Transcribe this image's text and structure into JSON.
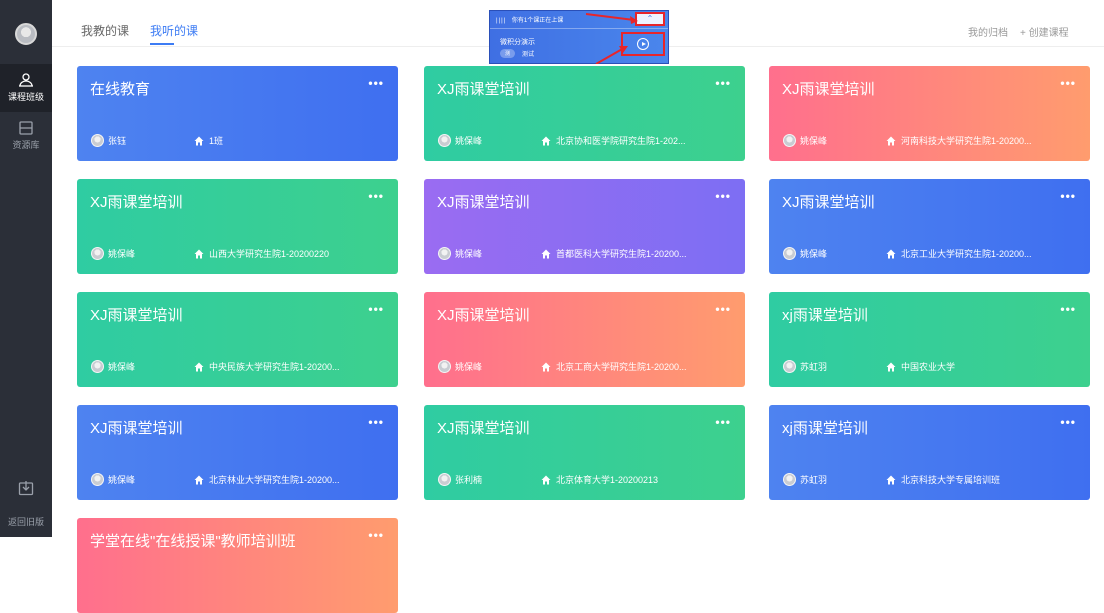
{
  "tabs": [
    {
      "label": "我教的课"
    },
    {
      "label": "我听的课"
    }
  ],
  "top_actions": {
    "archive": "我的归档",
    "create": "+ 创建课程"
  },
  "sidebar": {
    "items": [
      {
        "label": "课程班级"
      },
      {
        "label": "资源库"
      }
    ],
    "back_label": "返回旧版"
  },
  "notice": {
    "bars": "||||",
    "message": "你有1个课正在上课",
    "title": "微积分演示",
    "pill": "测",
    "sub": "测试"
  },
  "cards": [
    {
      "title": "在线教育",
      "teacher": "张钰",
      "class": "1班",
      "color": "blue"
    },
    {
      "title": "XJ雨课堂培训",
      "teacher": "姚保峰",
      "class": "北京协和医学院研究生院1-202...",
      "color": "teal"
    },
    {
      "title": "XJ雨课堂培训",
      "teacher": "姚保峰",
      "class": "河南科技大学研究生院1-20200...",
      "color": "pink"
    },
    {
      "title": "XJ雨课堂培训",
      "teacher": "姚保峰",
      "class": "山西大学研究生院1-20200220",
      "color": "teal"
    },
    {
      "title": "XJ雨课堂培训",
      "teacher": "姚保峰",
      "class": "首都医科大学研究生院1-20200...",
      "color": "purple"
    },
    {
      "title": "XJ雨课堂培训",
      "teacher": "姚保峰",
      "class": "北京工业大学研究生院1-20200...",
      "color": "blue"
    },
    {
      "title": "XJ雨课堂培训",
      "teacher": "姚保峰",
      "class": "中央民族大学研究生院1-20200...",
      "color": "teal"
    },
    {
      "title": "XJ雨课堂培训",
      "teacher": "姚保峰",
      "class": "北京工商大学研究生院1-20200...",
      "color": "pink"
    },
    {
      "title": "xj雨课堂培训",
      "teacher": "苏虹羽",
      "class": "中国农业大学",
      "color": "teal"
    },
    {
      "title": "XJ雨课堂培训",
      "teacher": "姚保峰",
      "class": "北京林业大学研究生院1-20200...",
      "color": "blue"
    },
    {
      "title": "XJ雨课堂培训",
      "teacher": "张利楠",
      "class": "北京体育大学1-20200213",
      "color": "teal"
    },
    {
      "title": "xj雨课堂培训",
      "teacher": "苏虹羽",
      "class": "北京科技大学专属培训班",
      "color": "blue"
    },
    {
      "title": "学堂在线\"在线授课\"教师培训班",
      "teacher": "",
      "class": "",
      "color": "pink"
    }
  ],
  "more_label": "•••",
  "colors": {
    "accent": "#3d7cf4",
    "sidebar": "#2b2f38"
  }
}
